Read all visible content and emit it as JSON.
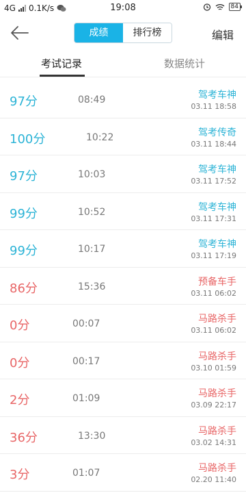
{
  "status_bar": {
    "network": "4G",
    "speed": "0.1K/s",
    "time": "19:08",
    "battery": "84"
  },
  "nav": {
    "segments": [
      "成绩",
      "排行榜"
    ],
    "active_segment": "成绩",
    "edit_label": "编辑"
  },
  "tabs": [
    "考试记录",
    "数据统计"
  ],
  "records": [
    {
      "score": "97分",
      "duration": "08:49",
      "title": "驾考车神",
      "date": "03.11  18:58",
      "status": "pass"
    },
    {
      "score": "100分",
      "duration": "10:22",
      "title": "驾考传奇",
      "date": "03.11  18:44",
      "status": "pass"
    },
    {
      "score": "97分",
      "duration": "10:03",
      "title": "驾考车神",
      "date": "03.11  17:52",
      "status": "pass"
    },
    {
      "score": "99分",
      "duration": "10:52",
      "title": "驾考车神",
      "date": "03.11  17:31",
      "status": "pass"
    },
    {
      "score": "99分",
      "duration": "10:17",
      "title": "驾考车神",
      "date": "03.11  17:19",
      "status": "pass"
    },
    {
      "score": "86分",
      "duration": "15:36",
      "title": "预备车手",
      "date": "03.11  06:02",
      "status": "fail"
    },
    {
      "score": "0分",
      "duration": "00:07",
      "title": "马路杀手",
      "date": "03.11  06:02",
      "status": "fail"
    },
    {
      "score": "0分",
      "duration": "00:17",
      "title": "马路杀手",
      "date": "03.10  01:59",
      "status": "fail"
    },
    {
      "score": "2分",
      "duration": "01:09",
      "title": "马路杀手",
      "date": "03.09  22:17",
      "status": "fail"
    },
    {
      "score": "36分",
      "duration": "13:30",
      "title": "马路杀手",
      "date": "03.02  14:31",
      "status": "fail"
    },
    {
      "score": "3分",
      "duration": "01:07",
      "title": "马路杀手",
      "date": "02.20  11:40",
      "status": "fail"
    }
  ],
  "colors": {
    "pass": "#2bb3d6",
    "fail": "#e86566",
    "accent": "#1ab3e6"
  },
  "icons": [
    "back-arrow-icon",
    "wechat-icon",
    "alarm-icon",
    "wifi-icon",
    "battery-icon"
  ]
}
